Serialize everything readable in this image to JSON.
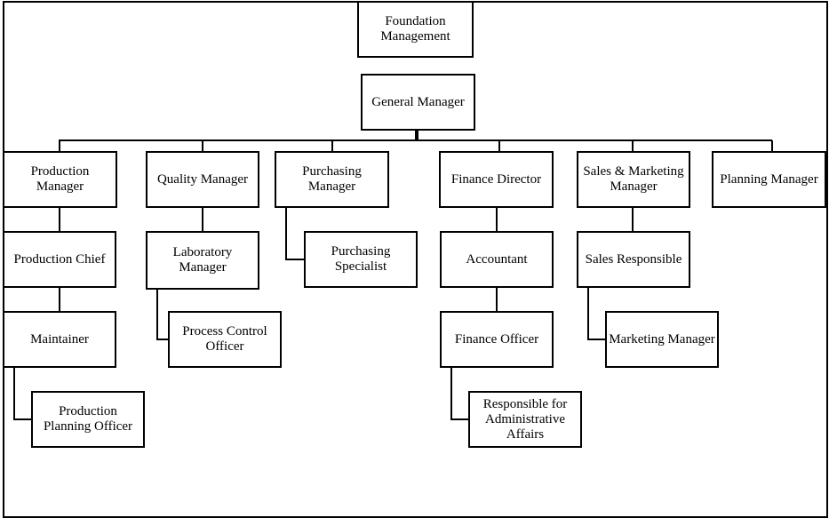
{
  "nodes": {
    "foundation": "Foundation Management",
    "general_manager": "General Manager",
    "production_manager": "Production Manager",
    "quality_manager": "Quality Manager",
    "purchasing_manager": "Purchasing Manager",
    "finance_director": "Finance Director",
    "sales_marketing_manager": "Sales & Marketing Manager",
    "planning_manager": "Planning Manager",
    "production_chief": "Production Chief",
    "maintainer": "Maintainer",
    "production_planning_officer": "Production Planning Officer",
    "laboratory_manager": "Laboratory Manager",
    "process_control_officer": "Process Control Officer",
    "purchasing_specialist": "Purchasing Specialist",
    "accountant": "Accountant",
    "finance_officer": "Finance Officer",
    "administrative_affairs": "Responsible for Administrative Affairs",
    "sales_responsible": "Sales Responsible",
    "marketing_manager": "Marketing Manager"
  },
  "colors": {
    "line": "#000000",
    "background": "#ffffff"
  }
}
